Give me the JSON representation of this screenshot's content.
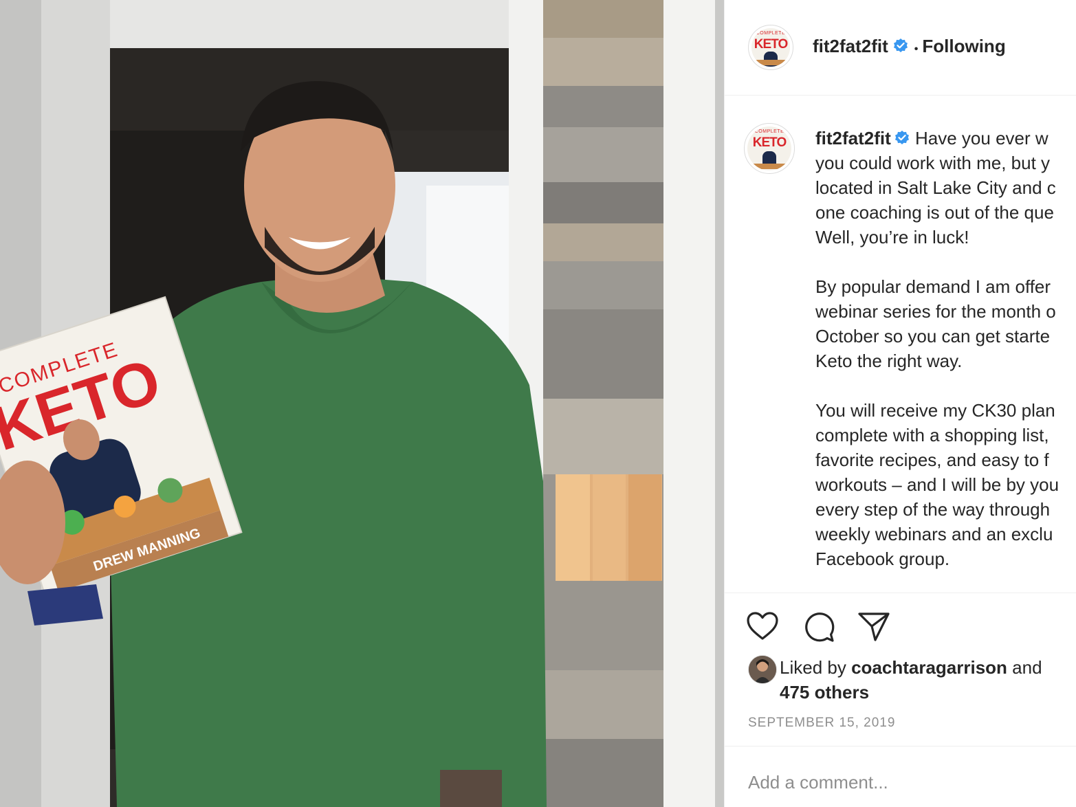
{
  "post": {
    "image_alt": "Man in green hoodie smiling and holding Complete Keto book",
    "book": {
      "series": "COMPLETE",
      "title": "KETO",
      "author": "DREW MANNING"
    }
  },
  "header": {
    "username": "fit2fat2fit",
    "verified_icon": "verified-badge-icon",
    "separator": "•",
    "follow_status": "Following"
  },
  "caption": {
    "username": "fit2fat2fit",
    "text": " Have you ever w\nyou could work with me, but y\nlocated in Salt Lake City and c\none coaching is out of the que\nWell, you’re in luck!\n\nBy popular demand I am offer\nwebinar series for the month o\nOctober so you can get starte\nKeto the right way.\n\nYou will receive my CK30 plan\ncomplete with a shopping list,\nfavorite recipes, and easy to f\nworkouts – and I will be by you\nevery step of the way through\nweekly webinars and an exclu\nFacebook group."
  },
  "actions": {
    "like_icon": "heart-icon",
    "comment_icon": "comment-icon",
    "share_icon": "share-icon"
  },
  "likes": {
    "prefix": "Liked by ",
    "user": "coachtaragarrison",
    "middle": " and",
    "others": "475 others"
  },
  "date": "SEPTEMBER 15, 2019",
  "comment": {
    "placeholder": "Add a comment..."
  },
  "colors": {
    "verified_blue": "#3897f0",
    "keto_red": "#d9262b",
    "hoodie_green": "#3f7a4a"
  }
}
